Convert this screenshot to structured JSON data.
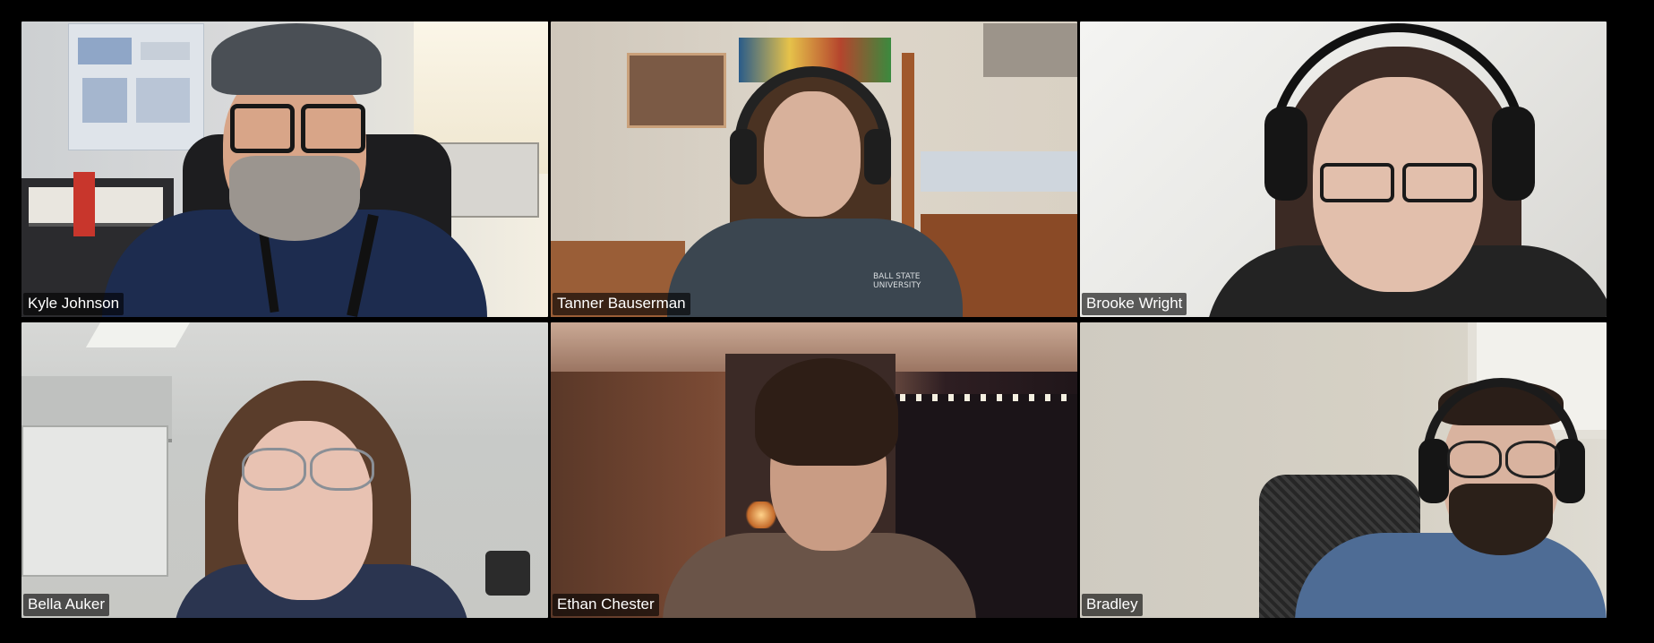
{
  "meeting": {
    "view": "gallery",
    "participants": [
      {
        "name": "Kyle Johnson"
      },
      {
        "name": "Tanner Bauserman",
        "shirt_text": "BALL STATE UNIVERSITY"
      },
      {
        "name": "Brooke Wright"
      },
      {
        "name": "Bella Auker"
      },
      {
        "name": "Ethan Chester"
      },
      {
        "name": "Bradley"
      }
    ]
  },
  "colors": {
    "background": "#000000",
    "name_tag_bg": "rgba(0,0,0,0.62)",
    "name_tag_text": "#ffffff"
  }
}
